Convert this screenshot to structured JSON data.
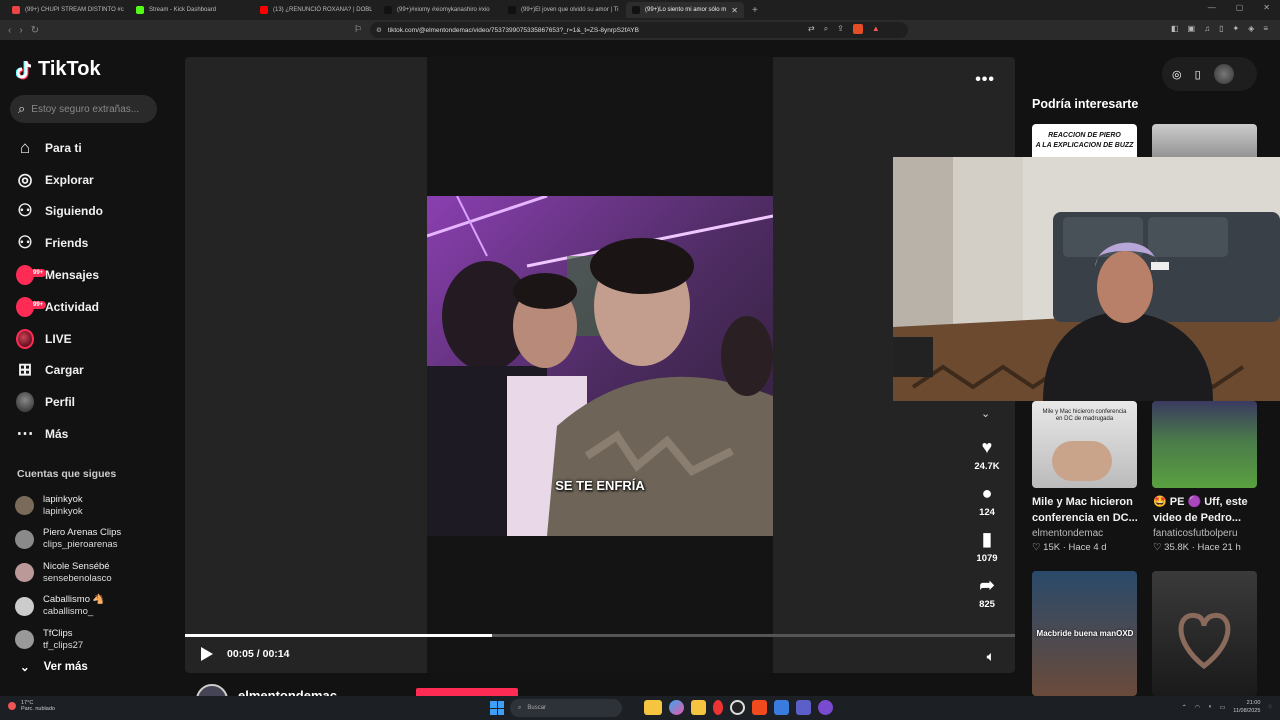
{
  "browser": {
    "tabs": [
      {
        "label": "(99+) CHUPI STREAM DISTINTO #cor",
        "color": "#e44"
      },
      {
        "label": "Stream - Kick Dashboard",
        "color": "#53fc18"
      },
      {
        "label": "(13) ¿RENUNCIÓ ROXANA? | DOBLE",
        "color": "#f00"
      },
      {
        "label": "(99+)#xiomy #xiomykanashiro #xio",
        "color": "#111"
      },
      {
        "label": "(99+)El joven que olvidó su amor | Ti",
        "color": "#111"
      },
      {
        "label": "(99+)Lo siento mi amor sólo m",
        "color": "#111",
        "active": true
      }
    ],
    "url": "tiktok.com/@elmentondemac/video/7537399075335867653?_r=1&_t=ZS-8ynrpS2fAYB"
  },
  "sidebar": {
    "logo": "TikTok",
    "search_placeholder": "Estoy seguro extrañas...",
    "nav": [
      {
        "label": "Para ti",
        "icon": "home-icon"
      },
      {
        "label": "Explorar",
        "icon": "compass-icon"
      },
      {
        "label": "Siguiendo",
        "icon": "following-icon"
      },
      {
        "label": "Friends",
        "icon": "friends-icon"
      },
      {
        "label": "Mensajes",
        "icon": "messages-icon",
        "badge": "99+"
      },
      {
        "label": "Actividad",
        "icon": "activity-icon",
        "badge": "99+"
      },
      {
        "label": "LIVE",
        "icon": "live-icon"
      },
      {
        "label": "Cargar",
        "icon": "upload-icon"
      },
      {
        "label": "Perfil",
        "icon": "profile-icon"
      },
      {
        "label": "Más",
        "icon": "more-icon"
      }
    ],
    "following_heading": "Cuentas que sigues",
    "following": [
      {
        "name": "lapinkyok",
        "handle": "lapinkyok",
        "color": "#7a6a5a"
      },
      {
        "name": "Piero Arenas Clips",
        "handle": "clips_pieroarenas",
        "color": "#8a8a8a"
      },
      {
        "name": "Nicole Sensébé",
        "handle": "sensebenolasco",
        "color": "#b99"
      },
      {
        "name": "Caballismo 🐴",
        "handle": "caballismo_",
        "color": "#ccc"
      },
      {
        "name": "TfClips",
        "handle": "tf_clips27",
        "color": "#999"
      }
    ],
    "see_more": "Ver más"
  },
  "video": {
    "subtitle": "SE TE ENFRÍA",
    "time": "00:05 / 00:14",
    "progress": 0.37,
    "likes": "24.7K",
    "comments": "124",
    "saves": "1079",
    "shares": "825",
    "author": "elmentondemac"
  },
  "recommendations": {
    "heading": "Podría interesarte",
    "top_card_caption_1": "REACCION DE PIERO",
    "top_card_caption_2": "A LA EXPLICACION DE BUZZ",
    "cards": [
      {
        "title": "Mile y Mac hicieron conferencia en DC...",
        "author": "elmentondemac",
        "likes": "15K",
        "age": "Hace 4 d",
        "thumb_caption": "Mile y Mac hicieron conferencia en DC de madrugada"
      },
      {
        "title": "🤩 PE 🟣 Uff, este video de Pedro...",
        "author": "fanaticosfutbolperu",
        "likes": "35.8K",
        "age": "Hace 21 h",
        "thumb_caption": ""
      }
    ],
    "bottom_thumb_caption": "Macbride buena manOXD"
  },
  "taskbar": {
    "weather_temp": "17°C",
    "weather_desc": "Parc. nublado",
    "search_label": "Buscar",
    "time": "21:00",
    "date": "11/08/2025"
  }
}
